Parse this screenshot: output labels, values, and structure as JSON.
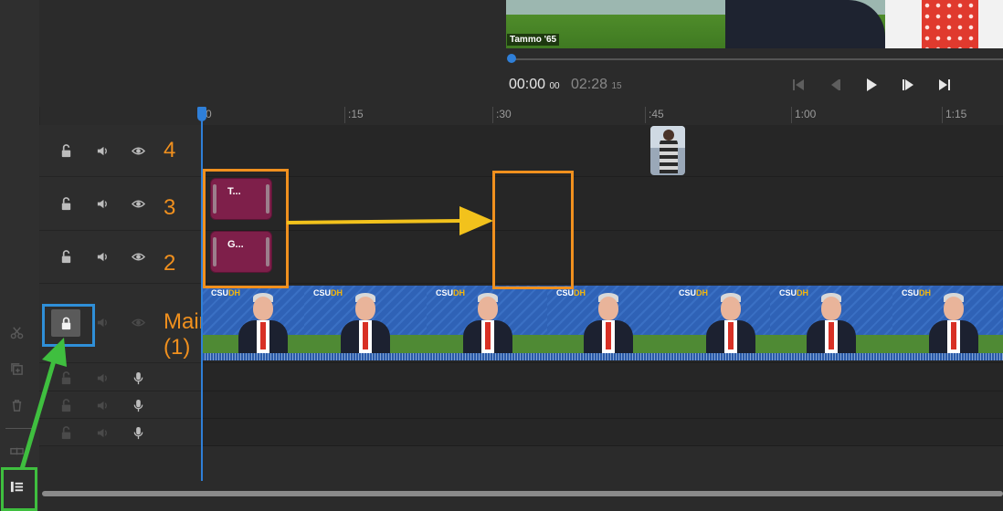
{
  "preview": {
    "lower_third": "Tammo '65"
  },
  "transport": {
    "current_time": "00:00",
    "current_frames": "00",
    "total_time": "02:28",
    "total_frames": "15"
  },
  "ruler": {
    "ticks": [
      "0",
      ":15",
      ":30",
      ":45",
      "1:00",
      "1:15"
    ]
  },
  "tracks": [
    {
      "label": "4"
    },
    {
      "label": "3"
    },
    {
      "label": "2"
    },
    {
      "label": "Main (1)"
    }
  ],
  "clips": {
    "title_clip_1": "T...",
    "title_clip_2": "G..."
  },
  "video_strip": {
    "logo_left": "CSU",
    "logo_right": "DH"
  },
  "colors": {
    "annotation_orange": "#f0901e",
    "annotation_yellow": "#f2c21c",
    "annotation_blue": "#2f8fd8",
    "annotation_green": "#3fbf3f",
    "playhead": "#2f7fd8",
    "title_clip": "#7e1f4a"
  },
  "icons": {
    "left_toolbar": [
      "scissors-icon",
      "duplicate-icon",
      "trash-icon",
      "split-icon",
      "track-toggle-icon"
    ],
    "track_controls": [
      "unlock-icon",
      "speaker-icon",
      "eye-icon",
      "microphone-icon"
    ],
    "transport": [
      "skip-start-icon",
      "step-back-icon",
      "play-icon",
      "step-forward-icon",
      "skip-end-icon"
    ]
  }
}
